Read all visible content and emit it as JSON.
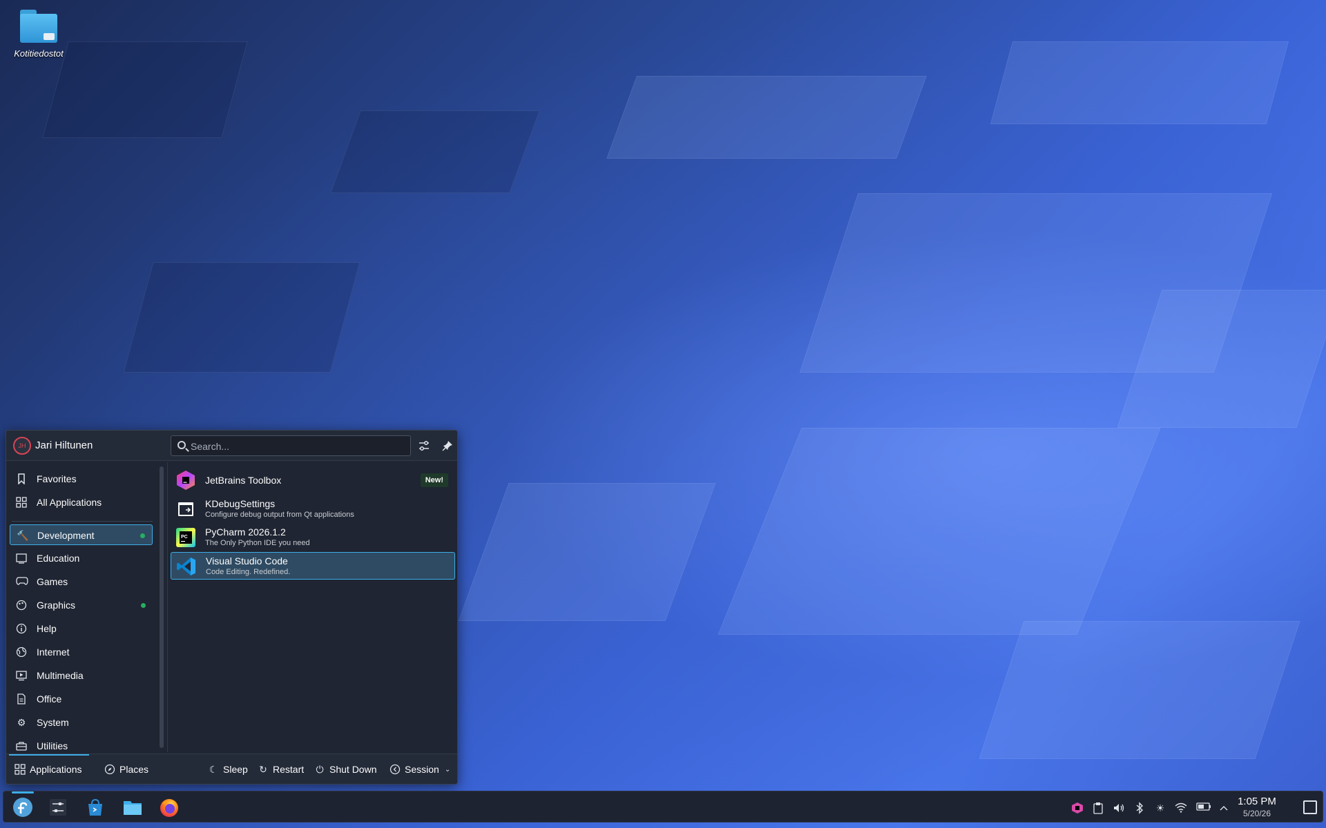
{
  "desktop": {
    "icons": [
      {
        "label": "Kotitiedostot",
        "icon": "folder-home-icon"
      }
    ]
  },
  "launcher": {
    "user": {
      "name": "Jari Hiltunen",
      "initials": "JH"
    },
    "search": {
      "placeholder": "Search..."
    },
    "header_buttons": [
      {
        "name": "configure-icon"
      },
      {
        "name": "pin-icon"
      }
    ],
    "sidebar": {
      "top_items": [
        {
          "label": "Favorites",
          "icon": "bookmark-icon"
        },
        {
          "label": "All Applications",
          "icon": "grid-icon"
        }
      ],
      "categories": [
        {
          "label": "Development",
          "icon": "hammer-icon",
          "active": true,
          "new_dot": true
        },
        {
          "label": "Education",
          "icon": "education-icon",
          "active": false,
          "new_dot": false
        },
        {
          "label": "Games",
          "icon": "gamepad-icon",
          "active": false,
          "new_dot": false
        },
        {
          "label": "Graphics",
          "icon": "graphics-icon",
          "active": false,
          "new_dot": true
        },
        {
          "label": "Help",
          "icon": "help-icon",
          "active": false,
          "new_dot": false
        },
        {
          "label": "Internet",
          "icon": "globe-icon",
          "active": false,
          "new_dot": false
        },
        {
          "label": "Multimedia",
          "icon": "multimedia-icon",
          "active": false,
          "new_dot": false
        },
        {
          "label": "Office",
          "icon": "office-icon",
          "active": false,
          "new_dot": false
        },
        {
          "label": "System",
          "icon": "gear-icon",
          "active": false,
          "new_dot": false
        },
        {
          "label": "Utilities",
          "icon": "utilities-icon",
          "active": false,
          "new_dot": false
        }
      ]
    },
    "apps": [
      {
        "name": "JetBrains Toolbox",
        "description": "",
        "badge": "New!",
        "icon": "jetbrains-toolbox-icon",
        "selected": false
      },
      {
        "name": "KDebugSettings",
        "description": "Configure debug output from Qt applications",
        "badge": "",
        "icon": "kdebugsettings-icon",
        "selected": false
      },
      {
        "name": "PyCharm 2026.1.2",
        "description": "The Only Python IDE you need",
        "badge": "",
        "icon": "pycharm-icon",
        "selected": false
      },
      {
        "name": "Visual Studio Code",
        "description": "Code Editing. Redefined.",
        "badge": "",
        "icon": "vscode-icon",
        "selected": true
      }
    ],
    "footer": {
      "tabs": [
        {
          "label": "Applications",
          "icon": "grid-icon",
          "active": true
        },
        {
          "label": "Places",
          "icon": "compass-icon",
          "active": false
        }
      ],
      "power": [
        {
          "label": "Sleep",
          "icon": "sleep-icon"
        },
        {
          "label": "Restart",
          "icon": "restart-icon"
        },
        {
          "label": "Shut Down",
          "icon": "power-icon"
        },
        {
          "label": "Session",
          "icon": "session-icon"
        }
      ]
    }
  },
  "taskbar": {
    "tasks": [
      {
        "name": "fedora-launcher-icon",
        "active": true
      },
      {
        "name": "system-settings-icon",
        "active": false
      },
      {
        "name": "discover-icon",
        "active": false
      },
      {
        "name": "dolphin-icon",
        "active": false
      },
      {
        "name": "firefox-icon",
        "active": false
      }
    ],
    "tray": [
      {
        "name": "jetbrains-tray-icon"
      },
      {
        "name": "clipboard-icon"
      },
      {
        "name": "volume-icon"
      },
      {
        "name": "bluetooth-icon"
      },
      {
        "name": "brightness-icon"
      },
      {
        "name": "wifi-icon"
      },
      {
        "name": "battery-icon"
      },
      {
        "name": "expand-tray-icon"
      }
    ],
    "clock": {
      "time": "1:05 PM",
      "date": "5/20/26"
    }
  },
  "colors": {
    "accent": "#3daee9",
    "new_dot": "#27ae60",
    "panel_bg": "#1f2532",
    "avatar_ring": "#da4453"
  }
}
